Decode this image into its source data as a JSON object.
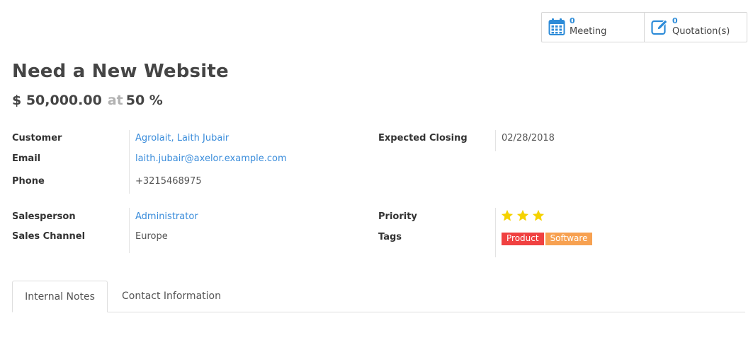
{
  "smart_buttons": {
    "meeting": {
      "count": "0",
      "label": "Meeting",
      "icon": "calendar-icon"
    },
    "quotation": {
      "count": "0",
      "label": "Quotation(s)",
      "icon": "edit-icon"
    }
  },
  "opportunity": {
    "title": "Need a New Website",
    "amount": "$ 50,000.00",
    "at_word": "at",
    "probability": "50 %"
  },
  "fields": {
    "customer_label": "Customer",
    "customer_value": "Agrolait, Laith Jubair",
    "email_label": "Email",
    "email_value": "laith.jubair@axelor.example.com",
    "phone_label": "Phone",
    "phone_value": "+3215468975",
    "expected_closing_label": "Expected Closing",
    "expected_closing_value": "02/28/2018",
    "salesperson_label": "Salesperson",
    "salesperson_value": "Administrator",
    "sales_channel_label": "Sales Channel",
    "sales_channel_value": "Europe",
    "priority_label": "Priority",
    "priority_stars": 3,
    "tags_label": "Tags",
    "tags": [
      {
        "label": "Product",
        "color": "#f04141"
      },
      {
        "label": "Software",
        "color": "#f7a151"
      }
    ]
  },
  "tabs": [
    {
      "label": "Internal Notes",
      "active": true
    },
    {
      "label": "Contact Information",
      "active": false
    }
  ],
  "colors": {
    "link": "#3b8ddb",
    "star": "#f5d200",
    "accent": "#2c8bd8"
  }
}
